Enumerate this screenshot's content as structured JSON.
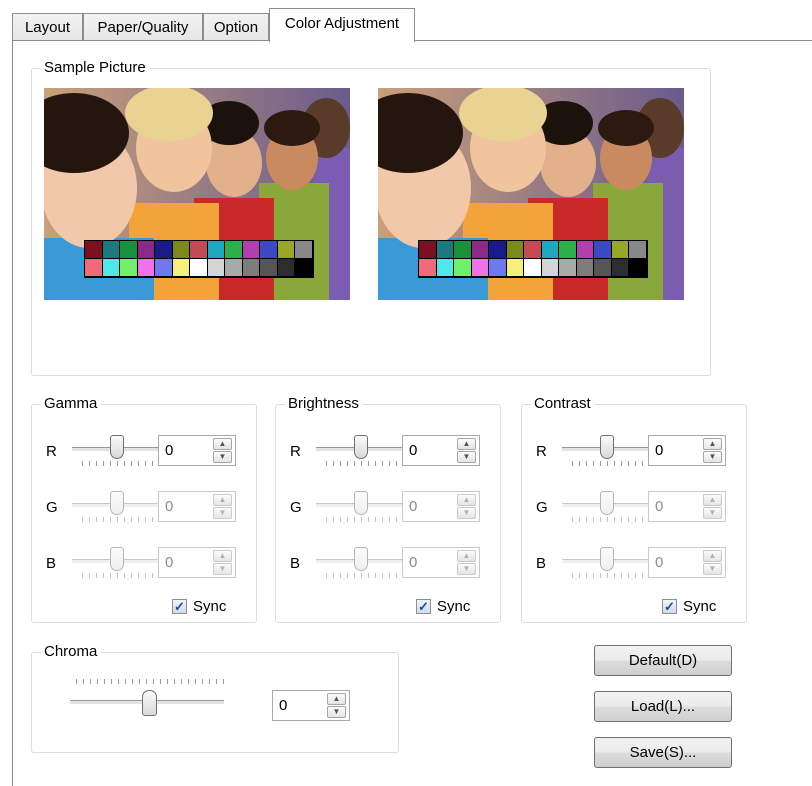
{
  "tabs": [
    "Layout",
    "Paper/Quality",
    "Option",
    "Color Adjustment"
  ],
  "active_tab": "Color Adjustment",
  "sample_picture": {
    "title": "Sample Picture",
    "swatch_colors": [
      [
        "#7a1020",
        "#1b7a7d",
        "#19913a",
        "#8b2a86",
        "#1a1a8a",
        "#7a8a1a",
        "#c44a55",
        "#1fa8c0",
        "#2bb04a",
        "#b43db0",
        "#3b49c6",
        "#98a826",
        "#888888"
      ],
      [
        "#f26a7a",
        "#4fe8ea",
        "#6ef06a",
        "#f071e8",
        "#7078ef",
        "#f6f07a",
        "#ffffff",
        "#d4d4d4",
        "#a8a8a8",
        "#7c7c7c",
        "#555555",
        "#2d2d2d",
        "#000000"
      ]
    ]
  },
  "groups": [
    {
      "title": "Gamma",
      "rows": [
        {
          "label": "R",
          "value": "0"
        },
        {
          "label": "G",
          "value": "0"
        },
        {
          "label": "B",
          "value": "0"
        }
      ],
      "sync_label": "Sync",
      "sync_checked": true
    },
    {
      "title": "Brightness",
      "rows": [
        {
          "label": "R",
          "value": "0"
        },
        {
          "label": "G",
          "value": "0"
        },
        {
          "label": "B",
          "value": "0"
        }
      ],
      "sync_label": "Sync",
      "sync_checked": true
    },
    {
      "title": "Contrast",
      "rows": [
        {
          "label": "R",
          "value": "0"
        },
        {
          "label": "G",
          "value": "0"
        },
        {
          "label": "B",
          "value": "0"
        }
      ],
      "sync_label": "Sync",
      "sync_checked": true
    }
  ],
  "chroma": {
    "title": "Chroma",
    "value": "0"
  },
  "buttons": {
    "default": "Default(D)",
    "load": "Load(L)...",
    "save": "Save(S)..."
  }
}
